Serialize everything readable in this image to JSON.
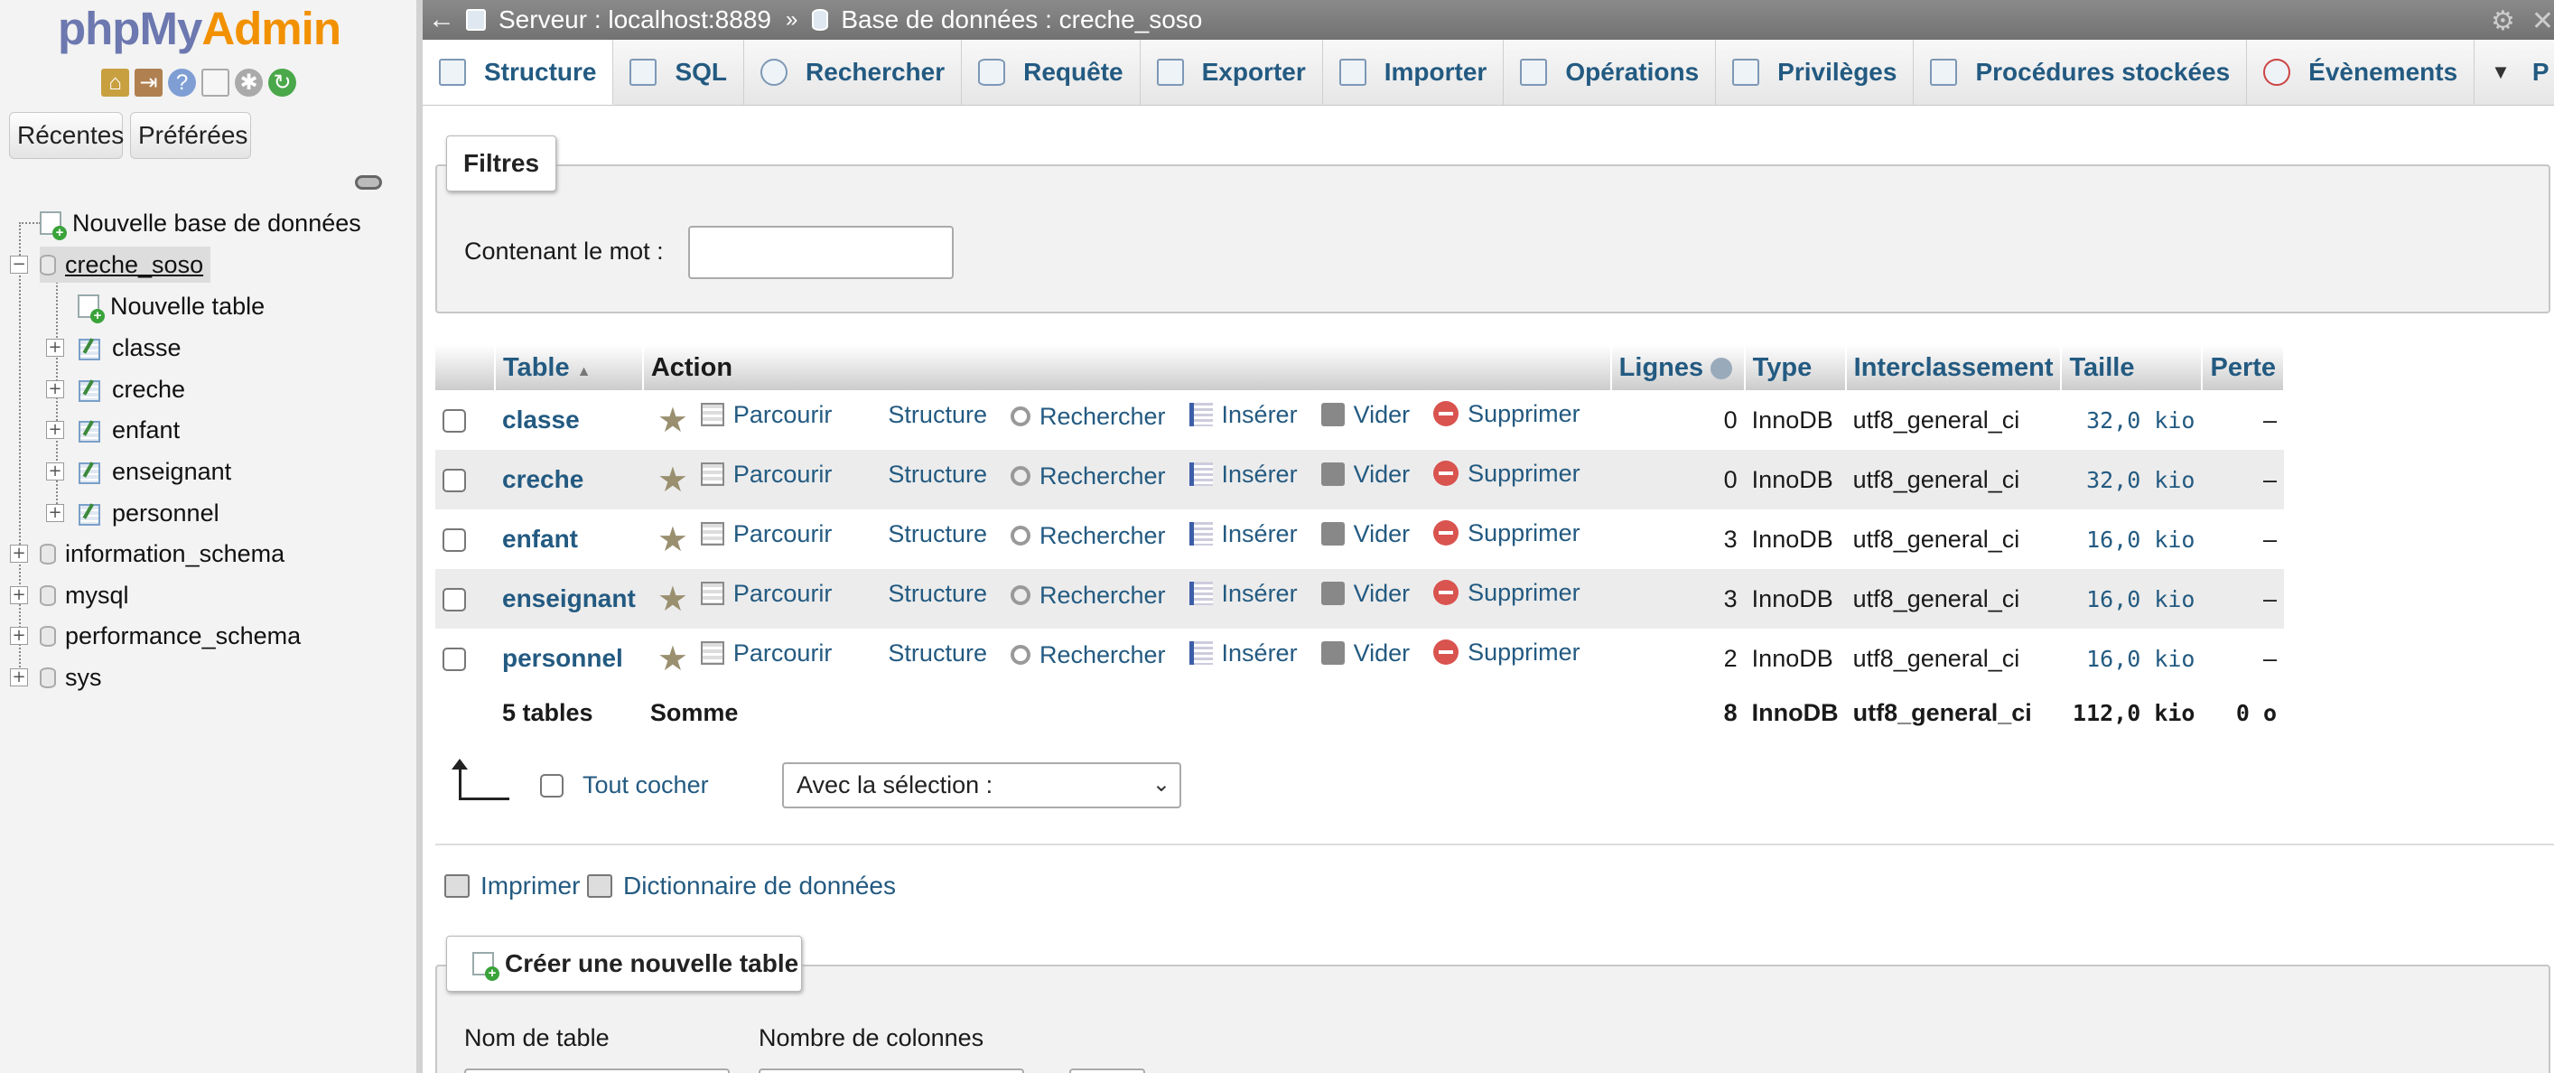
{
  "app": {
    "logo_php": "php",
    "logo_my": "My",
    "logo_admin": "Admin"
  },
  "sidebar": {
    "recent_label": "Récentes",
    "favorites_label": "Préférées",
    "new_db_label": "Nouvelle base de données",
    "databases": [
      {
        "name": "creche_soso",
        "expanded": true
      },
      {
        "name": "information_schema",
        "expanded": false
      },
      {
        "name": "mysql",
        "expanded": false
      },
      {
        "name": "performance_schema",
        "expanded": false
      },
      {
        "name": "sys",
        "expanded": false
      }
    ],
    "new_table_label": "Nouvelle table",
    "tables": [
      "classe",
      "creche",
      "enfant",
      "enseignant",
      "personnel"
    ]
  },
  "breadcrumb": {
    "server": "Serveur : localhost:8889",
    "separator": "»",
    "database": "Base de données : creche_soso"
  },
  "tabs": [
    {
      "label": "Structure",
      "icon": "structure-icon",
      "active": true
    },
    {
      "label": "SQL",
      "icon": "sql-icon"
    },
    {
      "label": "Rechercher",
      "icon": "search-icon"
    },
    {
      "label": "Requête",
      "icon": "query-icon"
    },
    {
      "label": "Exporter",
      "icon": "export-icon"
    },
    {
      "label": "Importer",
      "icon": "import-icon"
    },
    {
      "label": "Opérations",
      "icon": "wrench-icon"
    },
    {
      "label": "Privilèges",
      "icon": "privileges-icon"
    },
    {
      "label": "Procédures stockées",
      "icon": "routines-icon"
    },
    {
      "label": "Évènements",
      "icon": "clock-icon"
    },
    {
      "label": "P",
      "icon": "more-icon"
    }
  ],
  "filters": {
    "legend": "Filtres",
    "label": "Contenant le mot :",
    "value": ""
  },
  "table": {
    "headers": {
      "table": "Table",
      "action": "Action",
      "rows": "Lignes",
      "type": "Type",
      "collation": "Interclassement",
      "size": "Taille",
      "overhead": "Perte"
    },
    "actions": {
      "browse": "Parcourir",
      "structure": "Structure",
      "search": "Rechercher",
      "insert": "Insérer",
      "empty": "Vider",
      "drop": "Supprimer"
    },
    "rows": [
      {
        "name": "classe",
        "rows": "0",
        "type": "InnoDB",
        "collation": "utf8_general_ci",
        "size": "32,0 kio",
        "overhead": "–"
      },
      {
        "name": "creche",
        "rows": "0",
        "type": "InnoDB",
        "collation": "utf8_general_ci",
        "size": "32,0 kio",
        "overhead": "–"
      },
      {
        "name": "enfant",
        "rows": "3",
        "type": "InnoDB",
        "collation": "utf8_general_ci",
        "size": "16,0 kio",
        "overhead": "–"
      },
      {
        "name": "enseignant",
        "rows": "3",
        "type": "InnoDB",
        "collation": "utf8_general_ci",
        "size": "16,0 kio",
        "overhead": "–"
      },
      {
        "name": "personnel",
        "rows": "2",
        "type": "InnoDB",
        "collation": "utf8_general_ci",
        "size": "16,0 kio",
        "overhead": "–"
      }
    ],
    "summary": {
      "count": "5 tables",
      "label": "Somme",
      "rows": "8",
      "type": "InnoDB",
      "collation": "utf8_general_ci",
      "size": "112,0 kio",
      "overhead": "0 o"
    }
  },
  "bulk": {
    "check_all": "Tout cocher",
    "with_selected": "Avec la sélection :"
  },
  "links": {
    "print": "Imprimer",
    "dictionary": "Dictionnaire de données"
  },
  "create": {
    "legend": "Créer une nouvelle table",
    "table_name_label": "Nom de table",
    "columns_label": "Nombre de colonnes"
  },
  "colors": {
    "link": "#235a81",
    "logo_blue": "#6c78af",
    "logo_orange": "#f29100"
  }
}
